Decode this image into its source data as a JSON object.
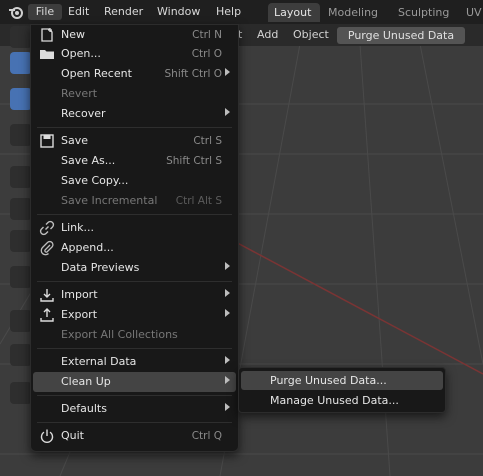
{
  "topbar": {
    "menus": [
      "File",
      "Edit",
      "Render",
      "Window",
      "Help"
    ],
    "workspaces": [
      "Layout",
      "Modeling",
      "Sculpting",
      "UV"
    ],
    "active_workspace": "Layout"
  },
  "header": {
    "items": [
      "t",
      "Add",
      "Object"
    ],
    "purge_button": "Purge Unused Data"
  },
  "file_menu": {
    "new": {
      "label": "New",
      "shortcut": "Ctrl N",
      "icon": "new-file-icon"
    },
    "open": {
      "label": "Open...",
      "shortcut": "Ctrl O",
      "icon": "folder-icon"
    },
    "open_recent": {
      "label": "Open Recent",
      "shortcut": "Shift Ctrl O"
    },
    "revert": {
      "label": "Revert"
    },
    "recover": {
      "label": "Recover"
    },
    "save": {
      "label": "Save",
      "shortcut": "Ctrl S",
      "icon": "save-icon"
    },
    "save_as": {
      "label": "Save As...",
      "shortcut": "Shift Ctrl S"
    },
    "save_copy": {
      "label": "Save Copy..."
    },
    "save_incremental": {
      "label": "Save Incremental",
      "shortcut": "Ctrl Alt S"
    },
    "link": {
      "label": "Link...",
      "icon": "link-icon"
    },
    "append": {
      "label": "Append...",
      "icon": "paperclip-icon"
    },
    "data_previews": {
      "label": "Data Previews"
    },
    "import": {
      "label": "Import",
      "icon": "import-icon"
    },
    "export": {
      "label": "Export",
      "icon": "export-icon"
    },
    "export_all": {
      "label": "Export All Collections"
    },
    "external_data": {
      "label": "External Data"
    },
    "clean_up": {
      "label": "Clean Up"
    },
    "defaults": {
      "label": "Defaults"
    },
    "quit": {
      "label": "Quit",
      "shortcut": "Ctrl Q",
      "icon": "power-icon"
    }
  },
  "cleanup_submenu": {
    "purge": "Purge Unused Data...",
    "manage": "Manage Unused Data..."
  },
  "colors": {
    "menu_bg": "#181818",
    "highlight": "#444444",
    "active_tool": "#4772b3",
    "x_axis": "#8a3a3a"
  }
}
